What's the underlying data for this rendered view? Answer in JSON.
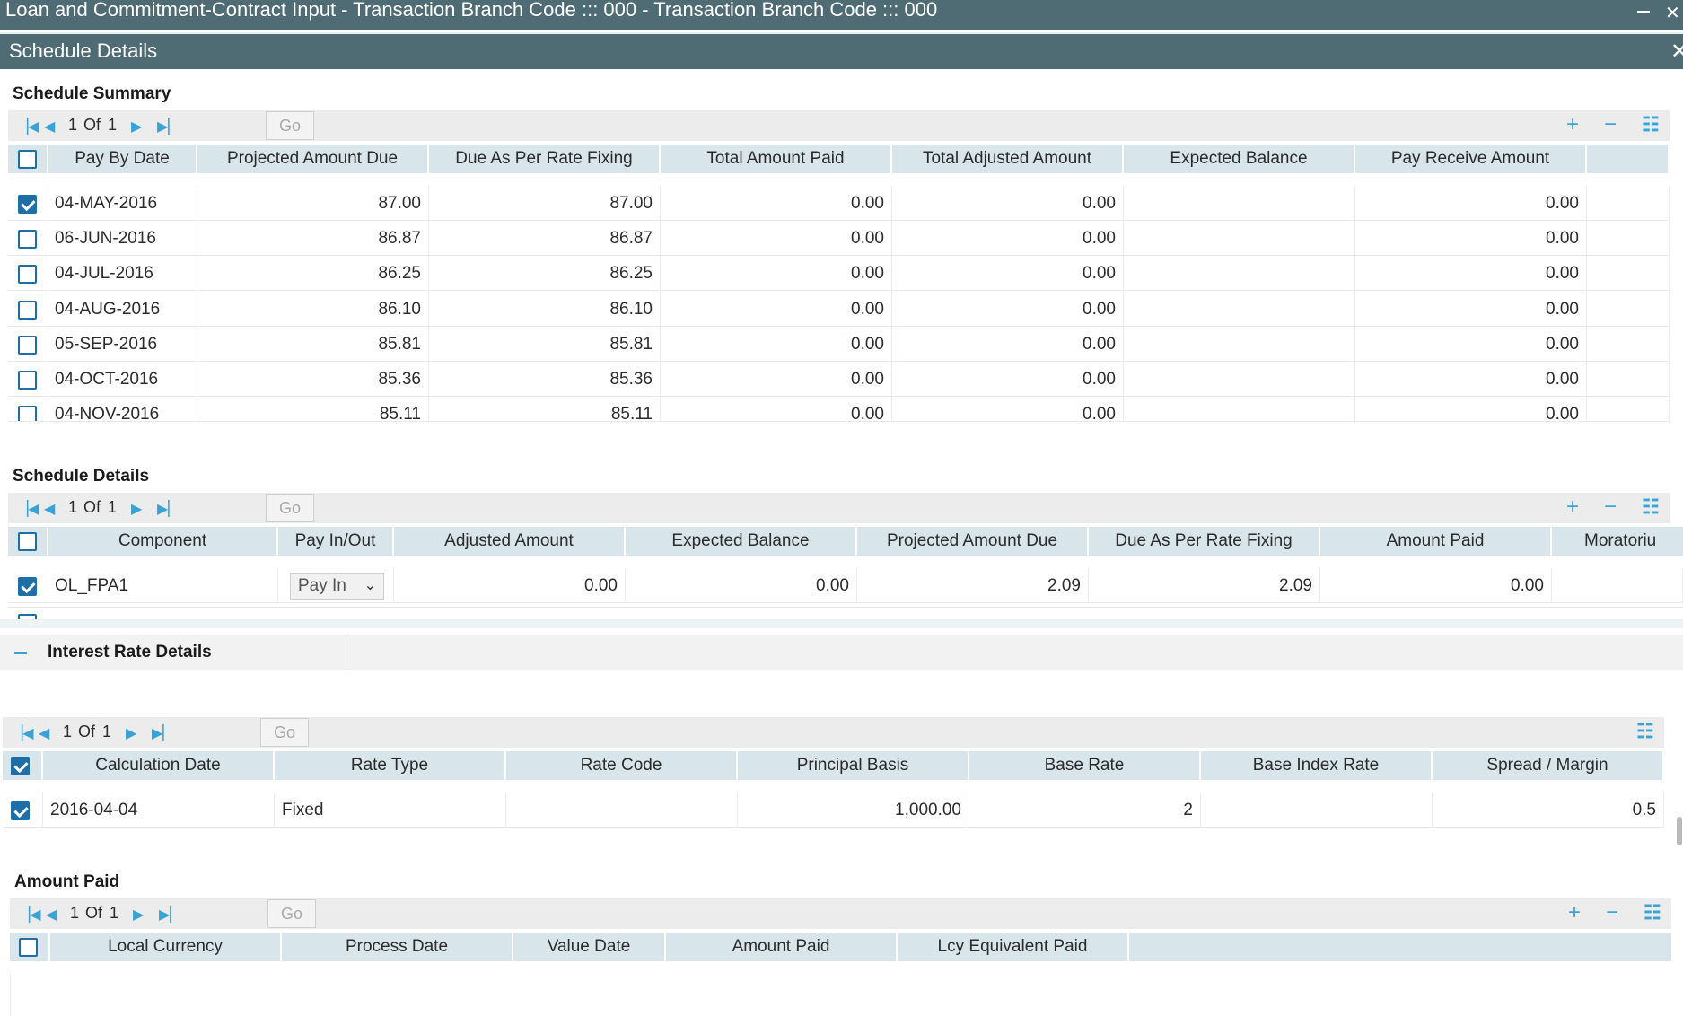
{
  "window": {
    "title": "Loan and Commitment-Contract Input - Transaction Branch Code ::: 000 - Transaction Branch Code ::: 000"
  },
  "dialog": {
    "title": "Schedule Details"
  },
  "pager": {
    "page": "1",
    "of_label": "Of",
    "total": "1",
    "go_label": "Go"
  },
  "schedule_summary": {
    "title": "Schedule Summary",
    "columns": [
      "Pay By Date",
      "Projected Amount Due",
      "Due As Per Rate Fixing",
      "Total Amount Paid",
      "Total Adjusted Amount",
      "Expected Balance",
      "Pay Receive Amount"
    ],
    "rows": [
      {
        "checked": true,
        "date": "04-MAY-2016",
        "projected": "87.00",
        "due_rate": "87.00",
        "paid": "0.00",
        "adjusted": "0.00",
        "expected": "",
        "pay_receive": "0.00"
      },
      {
        "checked": false,
        "date": "06-JUN-2016",
        "projected": "86.87",
        "due_rate": "86.87",
        "paid": "0.00",
        "adjusted": "0.00",
        "expected": "",
        "pay_receive": "0.00"
      },
      {
        "checked": false,
        "date": "04-JUL-2016",
        "projected": "86.25",
        "due_rate": "86.25",
        "paid": "0.00",
        "adjusted": "0.00",
        "expected": "",
        "pay_receive": "0.00"
      },
      {
        "checked": false,
        "date": "04-AUG-2016",
        "projected": "86.10",
        "due_rate": "86.10",
        "paid": "0.00",
        "adjusted": "0.00",
        "expected": "",
        "pay_receive": "0.00"
      },
      {
        "checked": false,
        "date": "05-SEP-2016",
        "projected": "85.81",
        "due_rate": "85.81",
        "paid": "0.00",
        "adjusted": "0.00",
        "expected": "",
        "pay_receive": "0.00"
      },
      {
        "checked": false,
        "date": "04-OCT-2016",
        "projected": "85.36",
        "due_rate": "85.36",
        "paid": "0.00",
        "adjusted": "0.00",
        "expected": "",
        "pay_receive": "0.00"
      },
      {
        "checked": false,
        "date": "04-NOV-2016",
        "projected": "85.11",
        "due_rate": "85.11",
        "paid": "0.00",
        "adjusted": "0.00",
        "expected": "",
        "pay_receive": "0.00"
      }
    ]
  },
  "schedule_details": {
    "title": "Schedule Details",
    "columns": [
      "Component",
      "Pay In/Out",
      "Adjusted Amount",
      "Expected Balance",
      "Projected Amount Due",
      "Due As Per Rate Fixing",
      "Amount Paid",
      "Moratoriu"
    ],
    "rows": [
      {
        "checked": true,
        "component": "OL_FPA1",
        "pay_in_out": "Pay In",
        "adjusted": "0.00",
        "expected": "0.00",
        "projected": "2.09",
        "due_rate": "2.09",
        "paid": "0.00"
      }
    ]
  },
  "interest_rate": {
    "title": "Interest Rate Details",
    "columns": [
      "Calculation Date",
      "Rate Type",
      "Rate Code",
      "Principal Basis",
      "Base Rate",
      "Base Index Rate",
      "Spread / Margin"
    ],
    "rows": [
      {
        "checked": true,
        "calc_date": "2016-04-04",
        "rate_type": "Fixed",
        "rate_code": "",
        "principal": "1,000.00",
        "base_rate": "2",
        "base_index": "",
        "spread": "0.5"
      }
    ]
  },
  "amount_paid": {
    "title": "Amount Paid",
    "columns": [
      "Local Currency",
      "Process Date",
      "Value Date",
      "Amount Paid",
      "Lcy Equivalent Paid"
    ]
  },
  "icons": {
    "first": "first-page-icon",
    "prev": "prev-page-icon",
    "next": "next-page-icon",
    "last": "last-page-icon",
    "add": "add-row-icon",
    "remove": "remove-row-icon",
    "list": "list-view-icon"
  },
  "colors": {
    "title_bar": "#4f6b74",
    "header": "#d8e5ea",
    "accent": "#3aa3d6",
    "checkbox": "#1e6fa8"
  }
}
